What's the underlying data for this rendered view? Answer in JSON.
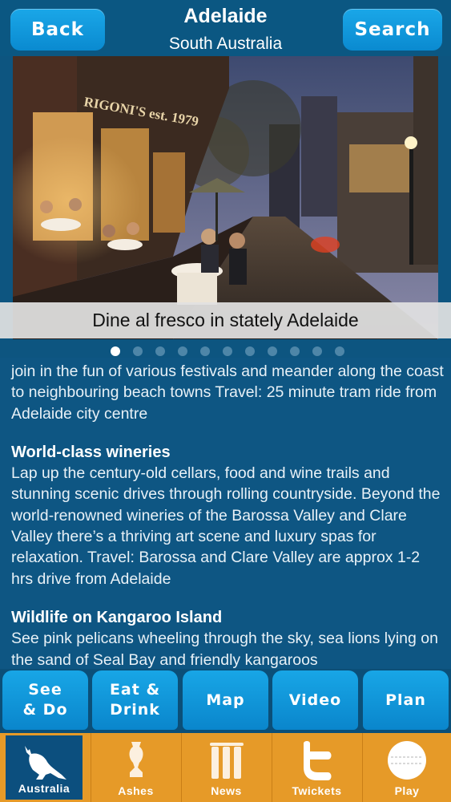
{
  "header": {
    "back_label": "Back",
    "title": "Adelaide",
    "subtitle": "South Australia",
    "search_label": "Search"
  },
  "hero": {
    "caption": "Dine al fresco in stately Adelaide",
    "signage": "RIGONI'S est. 1979",
    "page_count": 11,
    "active_page": 1
  },
  "article": {
    "intro": "join in the fun of various festivals and meander along the coast to neighbouring beach towns Travel: 25 minute tram ride from Adelaide city centre",
    "sections": [
      {
        "heading": "World-class wineries",
        "body": "Lap up the century-old cellars, food and wine trails and stunning scenic drives through rolling countryside. Beyond the world-renowned wineries of the Barossa Valley and Clare Valley there’s a thriving art scene and luxury spas for relaxation. Travel: Barossa and Clare Valley are approx 1-2 hrs drive from Adelaide"
      },
      {
        "heading": "Wildlife on Kangaroo Island",
        "body": "See pink pelicans wheeling through the sky, sea lions lying on the sand of Seal Bay and friendly kangaroos"
      }
    ]
  },
  "section_buttons": [
    {
      "label": "See\n& Do"
    },
    {
      "label": "Eat &\nDrink"
    },
    {
      "label": "Map"
    },
    {
      "label": "Video"
    },
    {
      "label": "Plan"
    }
  ],
  "tabs": [
    {
      "label": "Australia",
      "icon": "kangaroo-icon",
      "active": true
    },
    {
      "label": "Ashes",
      "icon": "ashes-urn-icon",
      "active": false
    },
    {
      "label": "News",
      "icon": "cricket-stumps-icon",
      "active": false
    },
    {
      "label": "Twickets",
      "icon": "twitter-t-icon",
      "active": false
    },
    {
      "label": "Play",
      "icon": "cricket-ball-icon",
      "active": false
    }
  ],
  "colors": {
    "background": "#0d5580",
    "button_blue": "#0a8ad0",
    "tab_orange": "#e69a28",
    "tab_active": "#0c4f7e"
  }
}
